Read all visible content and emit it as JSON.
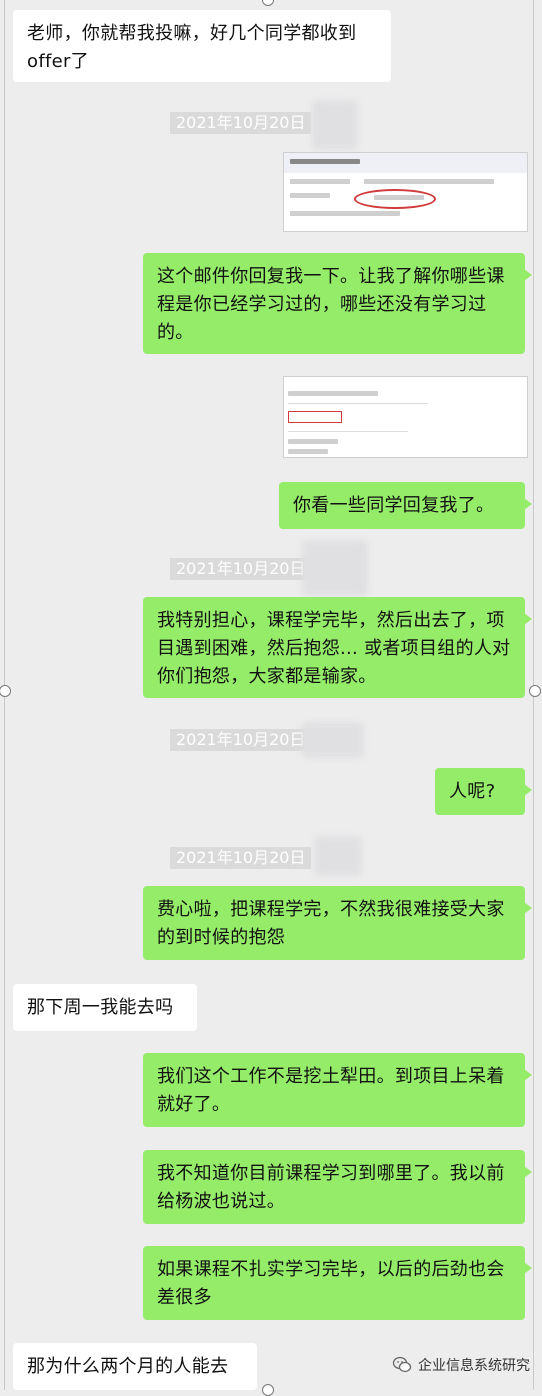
{
  "messages": [
    {
      "id": "m1",
      "side": "left",
      "text": "老师，你就帮我投嘛，好几个同学都收到offer了"
    },
    {
      "id": "t1",
      "type": "timestamp",
      "text": "2021年10月20日"
    },
    {
      "id": "i1",
      "type": "image",
      "side": "right",
      "desc": "email-screenshot"
    },
    {
      "id": "m2",
      "side": "right",
      "text": "这个邮件你回复我一下。让我了解你哪些课程是你已经学习过的，哪些还没有学习过的。"
    },
    {
      "id": "i2",
      "type": "image",
      "side": "right",
      "desc": "reply-screenshot"
    },
    {
      "id": "m3",
      "side": "right",
      "text": "你看一些同学回复我了。"
    },
    {
      "id": "t2",
      "type": "timestamp",
      "text": "2021年10月20日"
    },
    {
      "id": "m4",
      "side": "right",
      "text": "我特别担心，课程学完毕，然后出去了，项目遇到困难，然后抱怨... 或者项目组的人对你们抱怨，大家都是输家。"
    },
    {
      "id": "t3",
      "type": "timestamp",
      "text": "2021年10月20日"
    },
    {
      "id": "m5",
      "side": "right",
      "text": "人呢?"
    },
    {
      "id": "t4",
      "type": "timestamp",
      "text": "2021年10月20日"
    },
    {
      "id": "m6",
      "side": "right",
      "text": "费心啦，把课程学完，不然我很难接受大家的到时候的抱怨"
    },
    {
      "id": "m7",
      "side": "left",
      "text": "那下周一我能去吗"
    },
    {
      "id": "m8",
      "side": "right",
      "text": "我们这个工作不是挖土犁田。到项目上呆着就好了。"
    },
    {
      "id": "m9",
      "side": "right",
      "text": "我不知道你目前课程学习到哪里了。我以前给杨波也说过。"
    },
    {
      "id": "m10",
      "side": "right",
      "text": "如果课程不扎实学习完毕，以后的后劲也会差很多"
    },
    {
      "id": "m11",
      "side": "left",
      "text": "那为什么两个月的人能去"
    }
  ],
  "watermark": {
    "text": "企业信息系统研究",
    "icon": "wechat-icon"
  },
  "colors": {
    "background": "#ededed",
    "sent_bubble": "#95ec69",
    "received_bubble": "#ffffff",
    "timestamp_bg": "#dadada"
  }
}
